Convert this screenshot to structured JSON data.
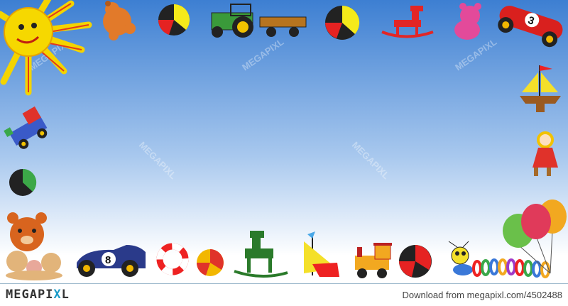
{
  "watermark": "MEGAPIXL",
  "footer": {
    "logo_main": "MEGAPI",
    "logo_x": "X",
    "logo_end": "L",
    "download_text": "Download from megapixl.com/4502488"
  },
  "colors": {
    "sky_top": "#3d7fd2",
    "sky_bottom": "#ffffff",
    "logo_accent": "#1a9bc8"
  },
  "toys": [
    "sun",
    "teddy-bear",
    "beach-ball",
    "tractor-with-trailer",
    "rocking-horse",
    "pink-teddy-bear",
    "race-car-3",
    "sailboat",
    "doll",
    "toy-train",
    "race-car-8",
    "life-ring",
    "spinning-top",
    "steam-locomotive",
    "caterpillar",
    "balloons",
    "teddy-bear-family"
  ]
}
